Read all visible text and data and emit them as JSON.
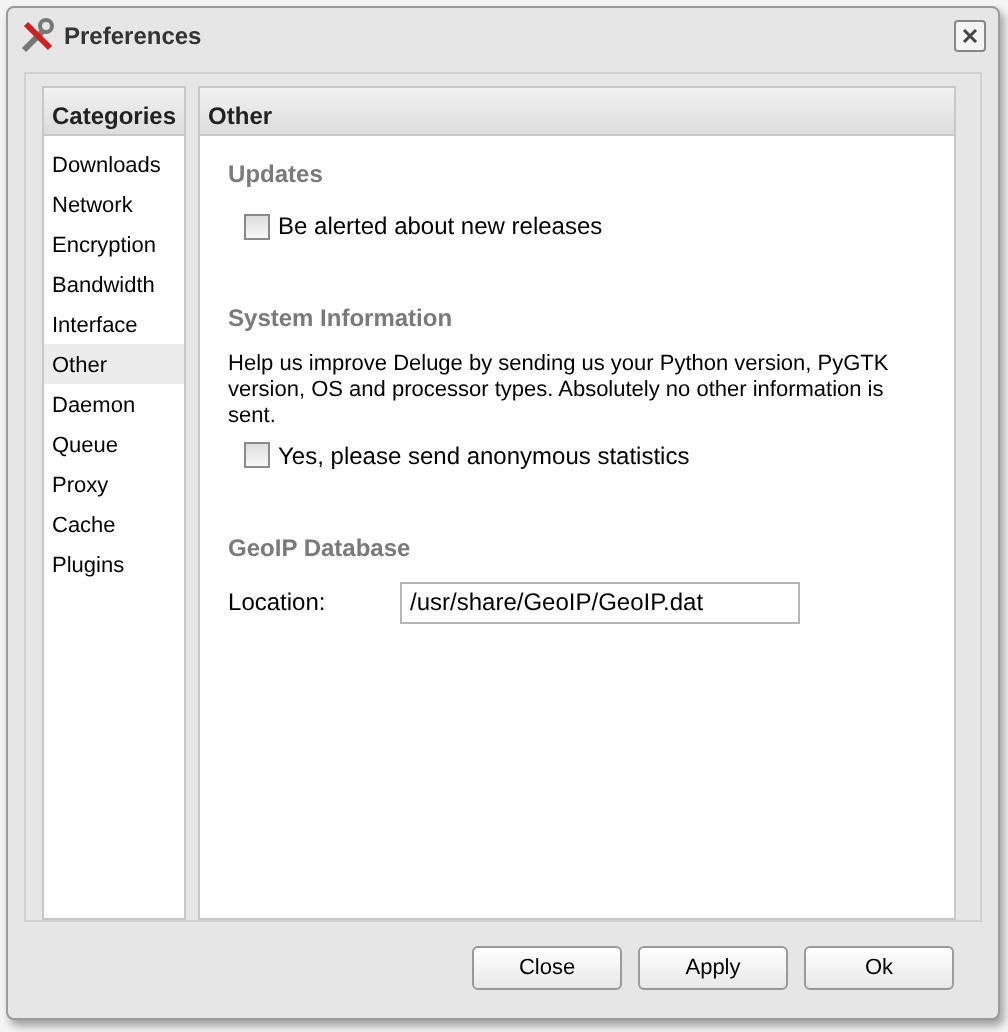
{
  "window": {
    "title": "Preferences"
  },
  "categories": {
    "title": "Categories",
    "items": [
      {
        "label": "Downloads",
        "selected": false
      },
      {
        "label": "Network",
        "selected": false
      },
      {
        "label": "Encryption",
        "selected": false
      },
      {
        "label": "Bandwidth",
        "selected": false
      },
      {
        "label": "Interface",
        "selected": false
      },
      {
        "label": "Other",
        "selected": true
      },
      {
        "label": "Daemon",
        "selected": false
      },
      {
        "label": "Queue",
        "selected": false
      },
      {
        "label": "Proxy",
        "selected": false
      },
      {
        "label": "Cache",
        "selected": false
      },
      {
        "label": "Plugins",
        "selected": false
      }
    ]
  },
  "panel": {
    "title": "Other",
    "sections": [
      {
        "title": "Updates",
        "items": [
          {
            "kind": "checkbox",
            "label": "Be alerted about new releases",
            "checked": false
          }
        ]
      },
      {
        "title": "System Information",
        "items": [
          {
            "kind": "text",
            "text": "Help us improve Deluge by sending us your Python version, PyGTK version, OS and processor types. Absolutely no other information is sent."
          },
          {
            "kind": "checkbox",
            "label": "Yes, please send anonymous statistics",
            "checked": false
          }
        ]
      },
      {
        "title": "GeoIP Database",
        "items": [
          {
            "kind": "field",
            "label": "Location:",
            "value": "/usr/share/GeoIP/GeoIP.dat"
          }
        ]
      }
    ]
  },
  "buttons": [
    "Close",
    "Apply",
    "Ok"
  ]
}
